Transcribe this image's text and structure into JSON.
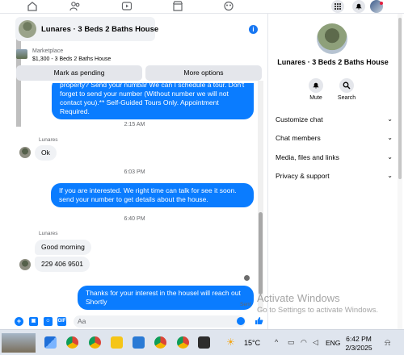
{
  "chat": {
    "title": "Lunares · 3 Beds 2 Baths House",
    "marketplace": {
      "label": "Marketplace",
      "detail": "$1,300 - 3 Beds 2 Baths House"
    },
    "buttons": {
      "mark_pending": "Mark as pending",
      "more_options": "More options"
    },
    "messages": {
      "m1": "property? Send your numbar We can I schedule a tour.  Don't forget to send your number (Without number we will not contact you).** Self-Guided Tours Only. Appointment Required.",
      "t1": "2:15 AM",
      "sender1": "Lunares",
      "m2": "Ok",
      "t2": "6:03 PM",
      "m3": "If you are interested. We right time can talk for see it soon. send your number to get details about the house.",
      "t3": "6:40 PM",
      "sender2": "Lunares",
      "m4": "Good morning",
      "m5": "229 406 9501",
      "m6": "Thanks for your interest in the housel will reach out Shortly",
      "status": "Sent"
    },
    "composer": {
      "placeholder": "Aa"
    }
  },
  "info": {
    "name": "Lunares · 3 Beds 2 Baths House",
    "actions": [
      "Mute",
      "Search"
    ],
    "sections": [
      "Customize chat",
      "Chat members",
      "Media, files and links",
      "Privacy & support"
    ]
  },
  "watermark": {
    "line1": "Activate Windows",
    "line2": "Go to Settings to activate Windows."
  },
  "taskbar": {
    "temperature": "15°C",
    "lang": "ENG",
    "time": "6:42 PM",
    "date": "2/3/2025"
  },
  "colors": {
    "accent": "#0a7cff",
    "bubble_in": "#f0f2f5"
  }
}
